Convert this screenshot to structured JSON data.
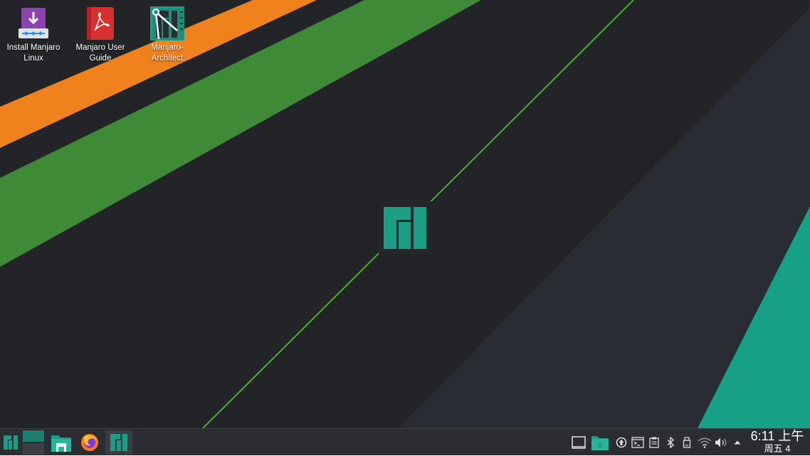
{
  "desktop": {
    "icons": [
      {
        "label": "Install Manjaro Linux",
        "icon": "install-download-icon"
      },
      {
        "label": "Manjaro User Guide",
        "icon": "pdf-document-icon"
      },
      {
        "label": "Manjaro-Architect",
        "icon": "manjaro-architect-icon"
      }
    ],
    "colors": {
      "background": "#222428",
      "orange": "#f0821e",
      "green": "#3f8a37",
      "teal": "#16a085",
      "logo": "#1b9d86"
    }
  },
  "taskbar": {
    "launchers": [
      "manjaro-menu-icon",
      "virtual-desktop-pager",
      "file-manager-icon",
      "firefox-icon",
      "manjaro-hello-icon"
    ],
    "tray": [
      "show-desktop-icon",
      "vault-folder-icon",
      "update-notifier-icon",
      "terminal-icon",
      "clipboard-icon",
      "bluetooth-icon",
      "usb-drive-icon",
      "wifi-icon",
      "volume-icon",
      "tray-expand-icon"
    ],
    "clock": {
      "time": "6:11 上午",
      "date": "周五 4"
    }
  }
}
